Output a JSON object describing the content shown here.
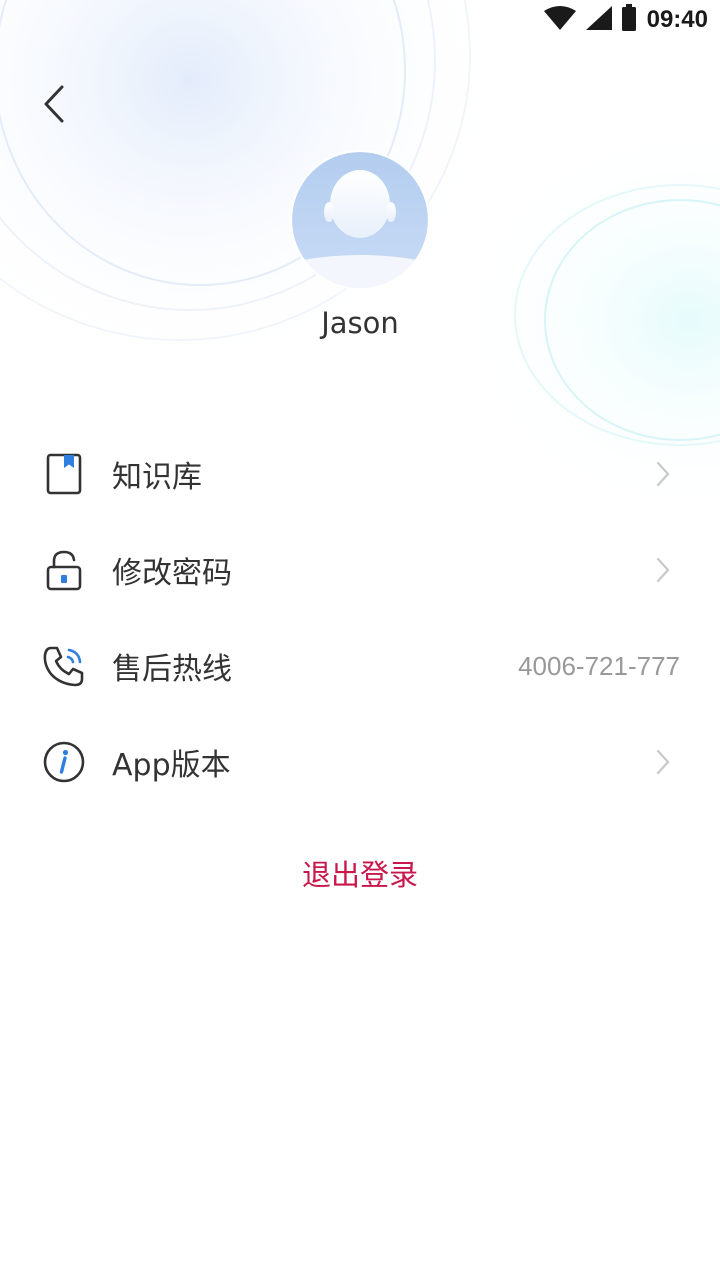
{
  "status_bar": {
    "time": "09:40",
    "icons": [
      "wifi-icon",
      "cell-signal-icon",
      "battery-icon"
    ]
  },
  "header": {
    "back_icon": "chevron-left-icon"
  },
  "profile": {
    "name": "Jason",
    "avatar_icon": "default-avatar-icon"
  },
  "menu": {
    "items": [
      {
        "label": "知识库",
        "icon": "book-icon",
        "trailing": "chevron"
      },
      {
        "label": "修改密码",
        "icon": "lock-icon",
        "trailing": "chevron"
      },
      {
        "label": "售后热线",
        "icon": "phone-icon",
        "trailing": "value",
        "value": "4006-721-777"
      },
      {
        "label": "App版本",
        "icon": "info-icon",
        "trailing": "chevron"
      }
    ]
  },
  "logout": {
    "label": "退出登录"
  },
  "colors": {
    "accent_blue": "#2f7fe0",
    "logout_red": "#c8174a",
    "text_primary": "#333333",
    "text_secondary": "#999999",
    "chevron": "#c8c8c8"
  }
}
